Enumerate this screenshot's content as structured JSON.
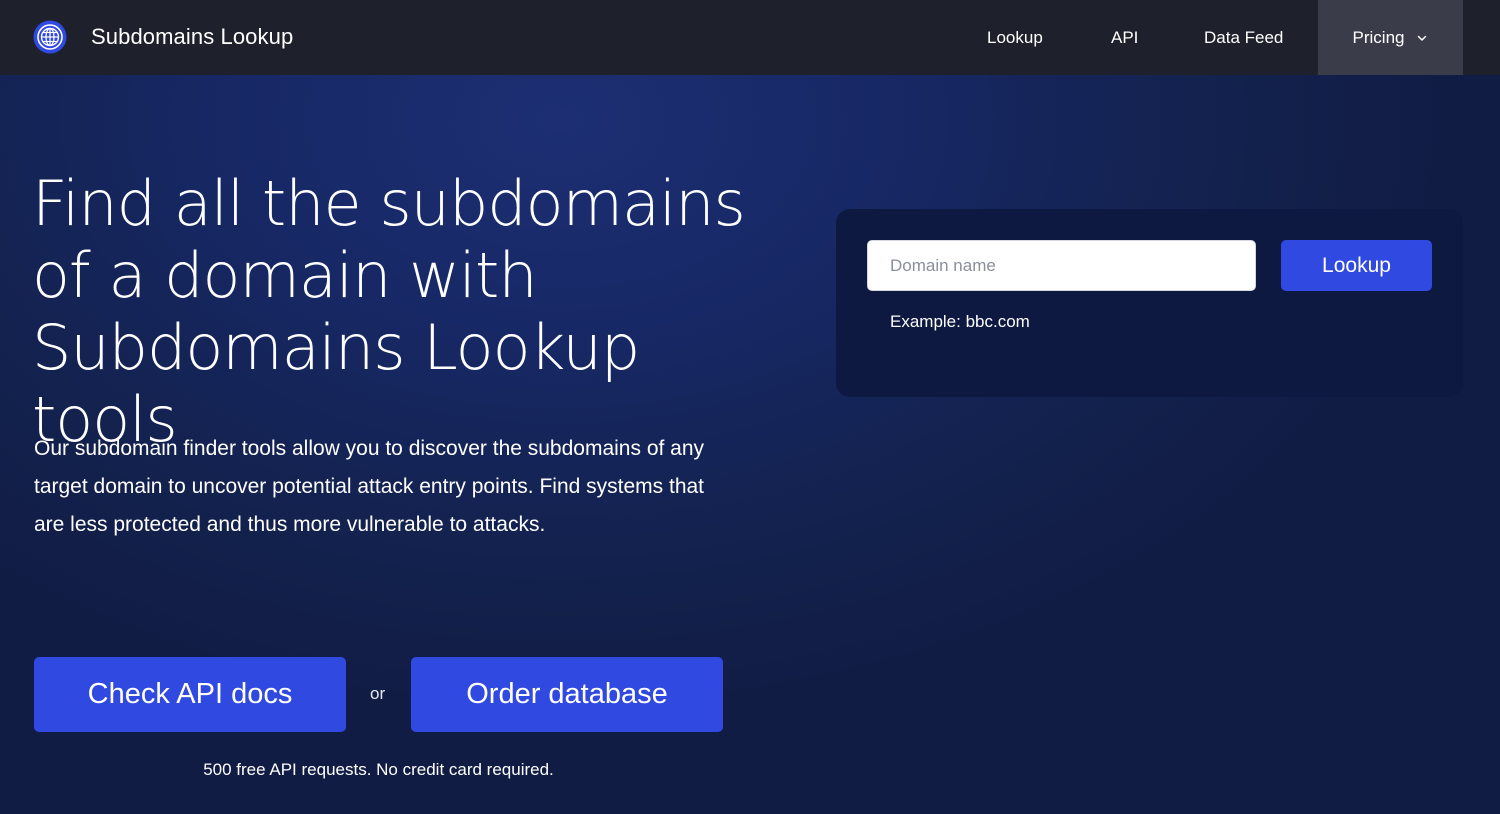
{
  "nav": {
    "brand": "Subdomains Lookup",
    "logo_icon": "globe-icon",
    "links": [
      {
        "label": "Lookup"
      },
      {
        "label": "API"
      },
      {
        "label": "Data Feed"
      },
      {
        "label": "Pricing",
        "icon": "chevron-down-icon"
      }
    ]
  },
  "hero": {
    "title": "Find all the subdomains of a domain with Subdomains Lookup tools",
    "description": "Our subdomain finder tools allow you to discover the subdomains of any target domain to uncover potential attack entry points. Find systems that are less protected and thus more vulnerable to attacks.",
    "buttons": {
      "api_docs": "Check API docs",
      "or": "or",
      "order_db": "Order database"
    },
    "note": "500 free API requests. No credit card required."
  },
  "lookup": {
    "placeholder": "Domain name",
    "value": "",
    "button": "Lookup",
    "example": "Example: bbc.com"
  },
  "colors": {
    "navbar": "#1e212b",
    "pricing_bg": "#3a3d49",
    "accent": "#3049e0",
    "card": "#0d1940",
    "page_bg": "#13224f"
  }
}
